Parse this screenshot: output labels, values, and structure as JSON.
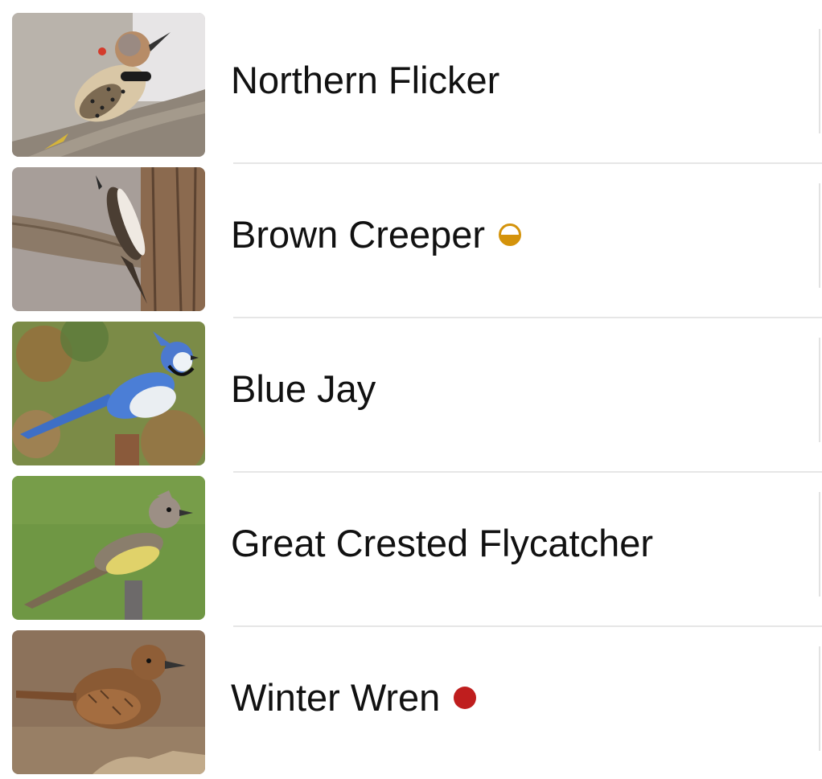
{
  "species_list": {
    "items": [
      {
        "name": "Northern Flicker",
        "status": "none"
      },
      {
        "name": "Brown Creeper",
        "status": "half-circle",
        "status_color": "#d4930b"
      },
      {
        "name": "Blue Jay",
        "status": "none"
      },
      {
        "name": "Great Crested Flycatcher",
        "status": "none"
      },
      {
        "name": "Winter Wren",
        "status": "filled-circle",
        "status_color": "#bf1e1e"
      }
    ]
  },
  "colors": {
    "text": "#111111",
    "divider": "#e6e6e6",
    "background": "#ffffff"
  }
}
